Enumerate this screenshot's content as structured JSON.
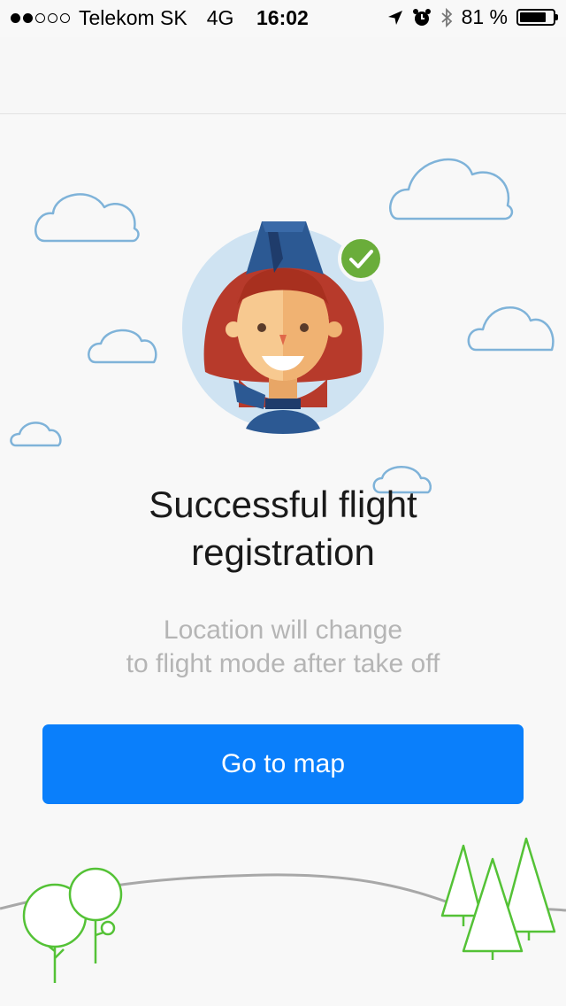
{
  "status_bar": {
    "carrier": "Telekom SK",
    "network": "4G",
    "time": "16:02",
    "battery_percent": "81 %",
    "battery_level": 0.81,
    "signal_bars": 2,
    "icons": [
      "location-arrow-icon",
      "alarm-clock-icon",
      "bluetooth-icon",
      "battery-icon"
    ]
  },
  "confirmation": {
    "title_line1": "Successful flight",
    "title_line2": "registration",
    "message_line1": "Location will change",
    "message_line2": "to flight mode after take off",
    "button_label": "Go to map"
  },
  "colors": {
    "accent": "#0a7ffb",
    "success": "#6aad3a",
    "cloud": "#7fb3d9",
    "tree": "#54c236"
  }
}
